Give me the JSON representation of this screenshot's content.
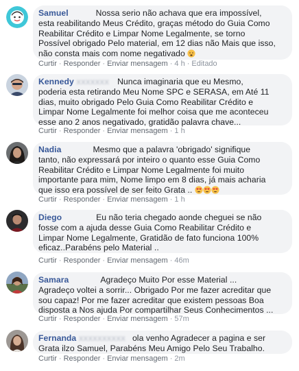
{
  "comments": [
    {
      "author": "Samuel",
      "lines": [
        "Nossa serio não achava que era impossível,",
        "esta reabilitando Meus Crédito, graças método do Guia Como",
        "Reabilitar Crédito e Limpar Nome Legalmente, se torno",
        "Possível obrigado Pelo material, em 12 dias não Mais que isso,",
        "não consta mais com nome negativado"
      ],
      "emoji": "worried-face",
      "actions": [
        "Curtir",
        "Responder",
        "Enviar mensagem"
      ],
      "time": "4 h",
      "edited": "Editado"
    },
    {
      "author": "Kennedy",
      "lines": [
        "Nunca imaginaria que eu Mesmo,",
        "poderia esta retirando Meu Nome SPC e SERASA, em Até 11",
        "dias, muito obrigado Pelo Guia Como Reabilitar Crédito e",
        "Limpar Nome Legalmente foi melhor coisa que me aconteceu",
        "esse ano 2 anos negativado, gratidão palavra chave..."
      ],
      "actions": [
        "Curtir",
        "Responder",
        "Enviar mensagem"
      ],
      "time": "1 h"
    },
    {
      "author": "Nadia",
      "lines": [
        "Mesmo que a palavra 'obrigado' signifique",
        "tanto, não expressará por inteiro o quanto esse Guia Como",
        "Reabilitar Crédito e Limpar Nome Legalmente foi muito",
        "importante para mim, Nome limpo em 8 dias, já mais acharia",
        "que isso era possível de ser feito Grata .."
      ],
      "emoji": "heart-eyes-face",
      "emoji_count": 3,
      "actions": [
        "Curtir",
        "Responder",
        "Enviar mensagem"
      ],
      "time": "1 h"
    },
    {
      "author": "Diego",
      "lines": [
        "Eu não teria chegado aonde cheguei se não",
        "fosse com a ajuda desse Guia Como Reabilitar Crédito e",
        "Limpar Nome Legalmente, Gratidão de fato funciona 100%",
        "eficaz..Parabéns pelo Material .."
      ],
      "actions": [
        "Curtir",
        "Responder",
        "Enviar mensagem"
      ],
      "time": "46m"
    },
    {
      "author": "Samara",
      "lines": [
        "Agradeço Muito Por esse Material ...",
        "Agradeço voltei a sorrir... Obrigado Por me fazer acreditar que",
        "sou capaz! Por me fazer acreditar que existem pessoas Boa",
        "disposta a Nos ajuda Por compartilhar Seus Conhecimentos ..."
      ],
      "actions": [
        "Curtir",
        "Responder",
        "Enviar mensagem"
      ],
      "time": "57m"
    },
    {
      "author": "Fernanda",
      "lines": [
        "ola venho Agradecer a pagina e ser",
        "Grata ilzo Samuel, Parabéns Meu Amigo Pelo Seu Trabalho."
      ],
      "actions": [
        "Curtir",
        "Responder",
        "Enviar mensagem"
      ],
      "time": "2m"
    }
  ],
  "colors": {
    "author": "#385898",
    "bubble": "#f2f3f5",
    "text": "#1c1e21",
    "meta": "#8d949e"
  }
}
